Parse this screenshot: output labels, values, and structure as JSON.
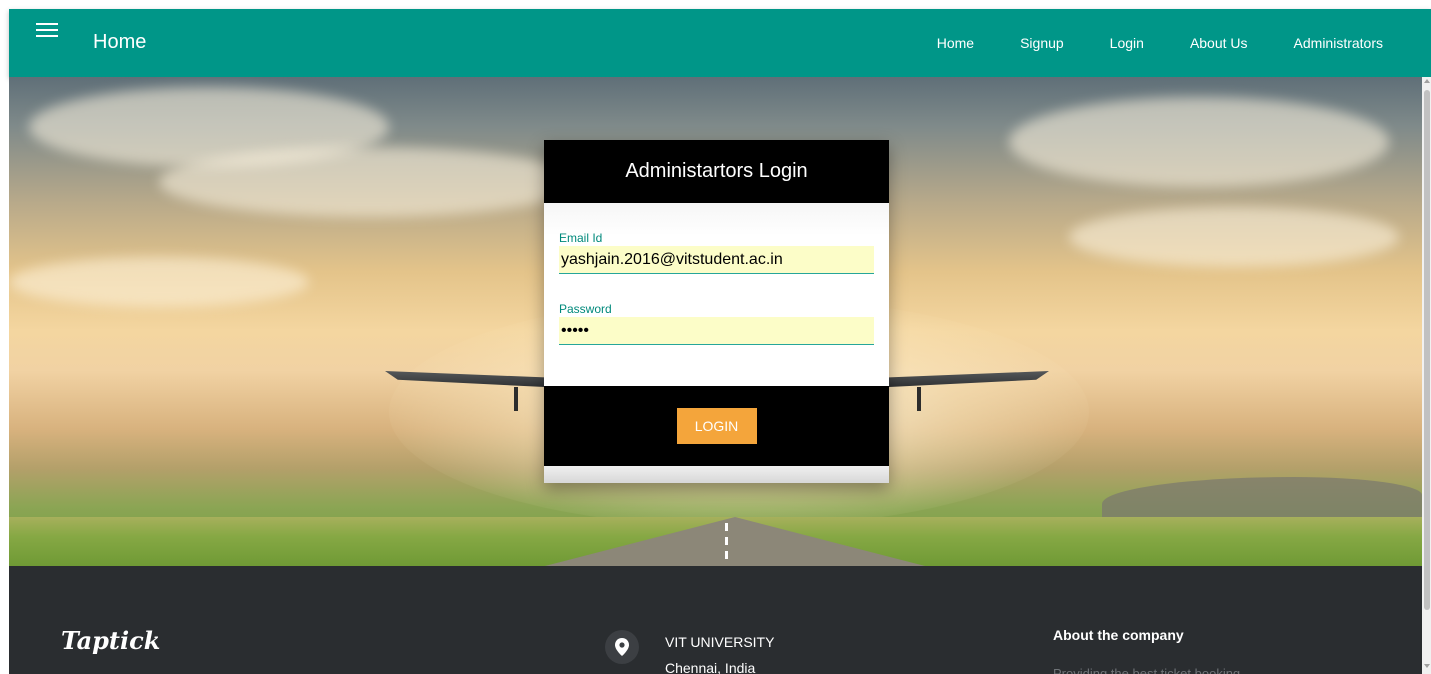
{
  "navbar": {
    "brand": "Home",
    "links": [
      "Home",
      "Signup",
      "Login",
      "About Us",
      "Administrators"
    ]
  },
  "login_card": {
    "title": "Administartors Login",
    "email_label": "Email Id",
    "email_value": "yashjain.2016@vitstudent.ac.in",
    "password_label": "Password",
    "password_value": "•••••",
    "login_button": "LOGIN"
  },
  "footer": {
    "logo": "Taptick",
    "address_line1": "VIT UNIVERSITY",
    "address_line2": "Chennai, India",
    "about_title": "About the company",
    "about_text": "Providing the best ticket booking"
  },
  "colors": {
    "navbar": "#009688",
    "login_button": "#f4a53b",
    "footer": "#2a2d30",
    "field_label": "#00897b"
  },
  "icons": {
    "menu": "hamburger-menu-icon",
    "location": "location-pin-icon"
  }
}
